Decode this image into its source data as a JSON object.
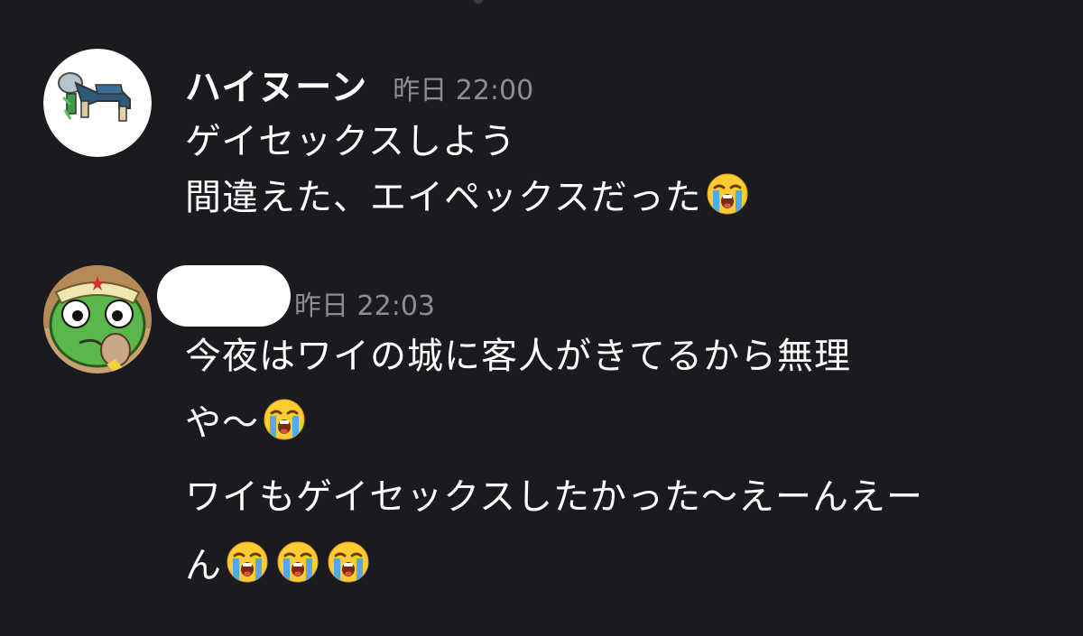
{
  "messages": [
    {
      "author": "ハイヌーン",
      "timestamp": "昨日 22:00",
      "lines": [
        {
          "text": "ゲイセックスしよう",
          "emojis": []
        },
        {
          "text": "間違えた、エイペックスだった",
          "emojis": [
            "loudly-crying-face"
          ]
        }
      ]
    },
    {
      "author_redacted": true,
      "timestamp": "昨日 22:03",
      "lines": [
        {
          "text": "今夜はワイの城に客人がきてるから無理",
          "emojis": []
        },
        {
          "text": "や〜",
          "emojis": [
            "loudly-crying-face"
          ]
        },
        {
          "text": "ワイもゲイセックスしたかった〜えーんえー",
          "emojis": []
        },
        {
          "text": "ん",
          "emojis": [
            "loudly-crying-face",
            "loudly-crying-face",
            "loudly-crying-face"
          ]
        }
      ]
    }
  ],
  "colors": {
    "background": "#1b1b1f",
    "text": "#ffffff",
    "timestamp": "#8c8c93"
  }
}
